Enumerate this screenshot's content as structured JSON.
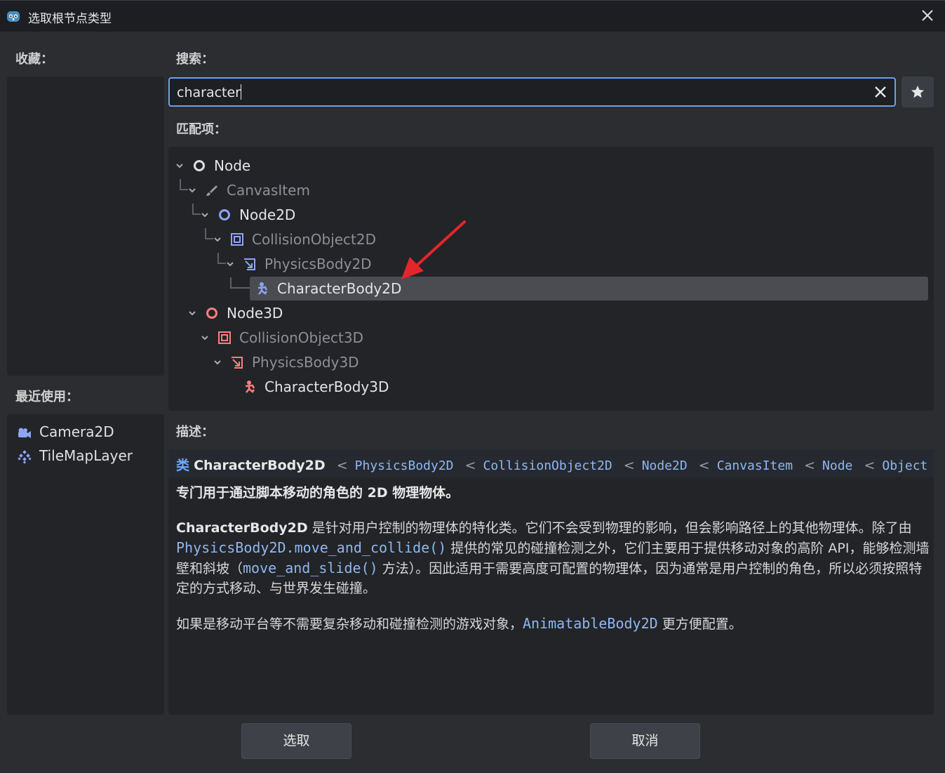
{
  "window": {
    "title": "选取根节点类型"
  },
  "favorites": {
    "label": "收藏："
  },
  "recent": {
    "label": "最近使用：",
    "items": [
      {
        "label": "Camera2D",
        "icon": "camera2d-icon"
      },
      {
        "label": "TileMapLayer",
        "icon": "tilemaplayer-icon"
      }
    ]
  },
  "search": {
    "label": "搜索：",
    "value": "character"
  },
  "matches": {
    "label": "匹配项：",
    "nodes": [
      {
        "label": "Node",
        "icon": "node-icon",
        "dim": false
      },
      {
        "label": "CanvasItem",
        "icon": "canvasitem-icon",
        "dim": true
      },
      {
        "label": "Node2D",
        "icon": "node2d-icon",
        "dim": false
      },
      {
        "label": "CollisionObject2D",
        "icon": "collisionobject2d-icon",
        "dim": true
      },
      {
        "label": "PhysicsBody2D",
        "icon": "physicsbody2d-icon",
        "dim": true
      },
      {
        "label": "CharacterBody2D",
        "icon": "characterbody2d-icon",
        "dim": false,
        "selected": true
      },
      {
        "label": "Node3D",
        "icon": "node3d-icon",
        "dim": false
      },
      {
        "label": "CollisionObject3D",
        "icon": "collisionobject3d-icon",
        "dim": true
      },
      {
        "label": "PhysicsBody3D",
        "icon": "physicsbody3d-icon",
        "dim": true
      },
      {
        "label": "CharacterBody3D",
        "icon": "characterbody3d-icon",
        "dim": false
      }
    ]
  },
  "description": {
    "label": "描述：",
    "class_keyword": "类",
    "class_name": "CharacterBody2D",
    "separator": "<",
    "inheritance": [
      "PhysicsBody2D",
      "CollisionObject2D",
      "Node2D",
      "CanvasItem",
      "Node",
      "Object"
    ],
    "summary": "专门用于通过脚本移动的角色的 2D 物理物体。",
    "p1_strong": "CharacterBody2D",
    "p1_a": " 是针对用户控制的物理体的特化类。它们不会受到物理的影响，但会影响路径上的其他物理体。除了由 ",
    "p1_link1": "PhysicsBody2D.move_and_collide()",
    "p1_b": " 提供的常见的碰撞检测之外，它们主要用于提供移动对象的高阶 API，能够检测墙壁和斜坡（",
    "p1_link2": "move_and_slide()",
    "p1_c": " 方法）。因此适用于需要高度可配置的物理体，因为通常是用户控制的角色，所以必须按照特定的方式移动、与世界发生碰撞。",
    "p2_a": "如果是移动平台等不需要复杂移动和碰撞检测的游戏对象，",
    "p2_link": "AnimatableBody2D",
    "p2_b": " 更方便配置。"
  },
  "buttons": {
    "select": "选取",
    "cancel": "取消"
  },
  "colors": {
    "accent": "#6ea0e6",
    "node2d_blue": "#8da5f3",
    "node3d_red": "#fc7f7f",
    "annotation_arrow": "#e3262b"
  }
}
